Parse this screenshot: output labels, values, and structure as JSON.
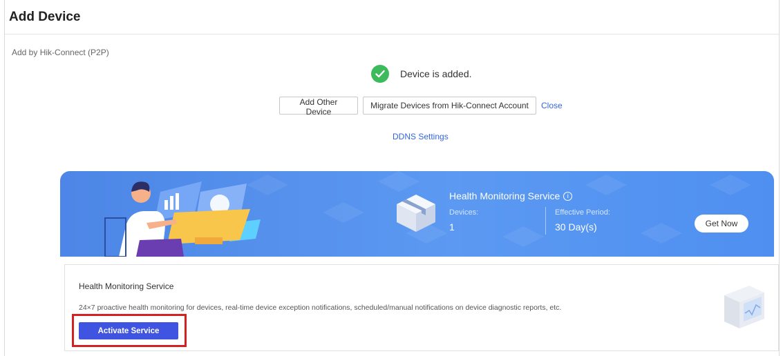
{
  "header": {
    "title": "Add Device"
  },
  "subtitle": "Add by Hik-Connect (P2P)",
  "status": {
    "message": "Device is added.",
    "color": "#3dbb5c"
  },
  "actions": {
    "add_other": "Add Other Device",
    "migrate": "Migrate Devices from Hik-Connect Account",
    "close": "Close",
    "ddns": "DDNS Settings"
  },
  "banner": {
    "title": "Health Monitoring Service",
    "devices_label": "Devices:",
    "devices_value": "1",
    "period_label": "Effective Period:",
    "period_value": "30 Day(s)",
    "get_now": "Get Now"
  },
  "card": {
    "title": "Health Monitoring Service",
    "description": "24×7 proactive health monitoring for devices, real-time device exception notifications, scheduled/manual notifications on device diagnostic reports, etc.",
    "activate": "Activate Service"
  },
  "colors": {
    "accent": "#3f54e0",
    "banner": "#5b99f2",
    "link": "#3366dd",
    "highlight": "#d32020"
  }
}
